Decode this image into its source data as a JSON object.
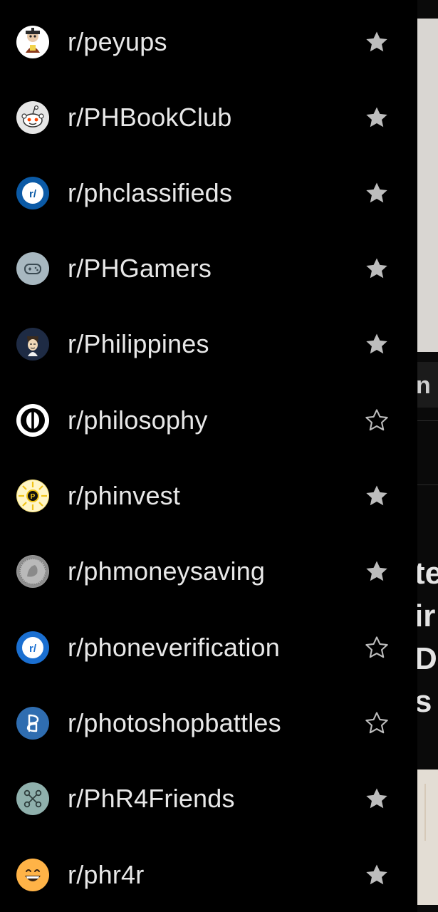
{
  "communities": [
    {
      "name": "r/peyups",
      "favorite": true,
      "icon": "peyups-icon"
    },
    {
      "name": "r/PHBookClub",
      "favorite": true,
      "icon": "reddit-snoo-icon"
    },
    {
      "name": "r/phclassifieds",
      "favorite": true,
      "icon": "subreddit-r-icon"
    },
    {
      "name": "r/PHGamers",
      "favorite": true,
      "icon": "gamepad-icon"
    },
    {
      "name": "r/Philippines",
      "favorite": true,
      "icon": "philippines-icon"
    },
    {
      "name": "r/philosophy",
      "favorite": false,
      "icon": "philosophy-icon"
    },
    {
      "name": "r/phinvest",
      "favorite": true,
      "icon": "phinvest-icon"
    },
    {
      "name": "r/phmoneysaving",
      "favorite": true,
      "icon": "coin-icon"
    },
    {
      "name": "r/phoneverification",
      "favorite": false,
      "icon": "subreddit-r-icon"
    },
    {
      "name": "r/photoshopbattles",
      "favorite": false,
      "icon": "photoshopbattles-icon"
    },
    {
      "name": "r/PhR4Friends",
      "favorite": true,
      "icon": "friends-network-icon"
    },
    {
      "name": "r/phr4r",
      "favorite": true,
      "icon": "smiley-icon"
    }
  ],
  "background_feed": {
    "strip_text": "n M",
    "title_fragments": [
      "te",
      "ir",
      "Dc",
      "s"
    ]
  },
  "colors": {
    "star_filled": "#bdbdbd",
    "star_outline": "#bdbdbd",
    "text": "#e8e8e8",
    "background": "#000000"
  }
}
